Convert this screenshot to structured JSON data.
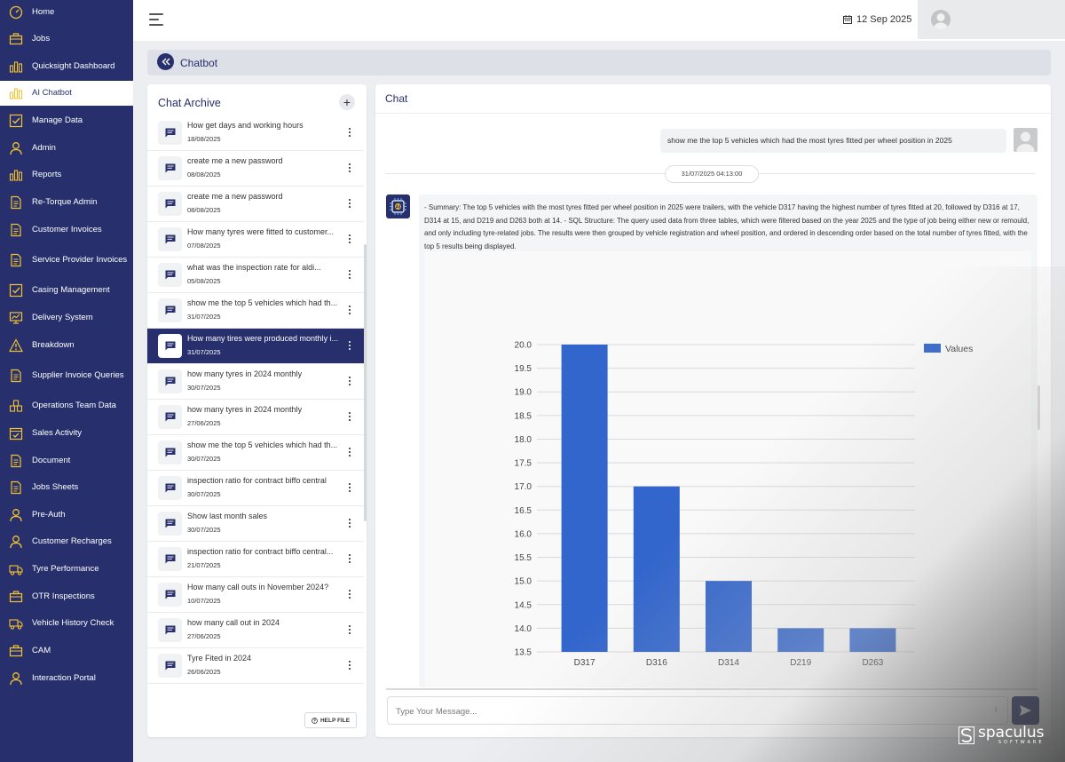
{
  "sidebar": {
    "items": [
      {
        "label": "Home",
        "icon": "dashboard-gauge-icon"
      },
      {
        "label": "Jobs",
        "icon": "briefcase-icon"
      },
      {
        "label": "Quicksight Dashboard",
        "icon": "bar-chart-icon"
      },
      {
        "label": "AI Chatbot",
        "icon": "bar-chart-icon",
        "active": true
      },
      {
        "label": "Manage Data",
        "icon": "checkbox-icon"
      },
      {
        "label": "Admin",
        "icon": "user-icon"
      },
      {
        "label": "Reports",
        "icon": "bar-chart-icon"
      },
      {
        "label": "Re-Torque Admin",
        "icon": "document-icon"
      },
      {
        "label": "Customer Invoices",
        "icon": "document-icon"
      },
      {
        "label": "Service Provider Invoices",
        "icon": "document-icon"
      },
      {
        "label": "Casing Management",
        "icon": "checkbox-icon"
      },
      {
        "label": "Delivery System",
        "icon": "monitor-chart-icon"
      },
      {
        "label": "Breakdown",
        "icon": "warning-icon"
      },
      {
        "label": "Supplier Invoice Queries",
        "icon": "document-icon"
      },
      {
        "label": "Operations Team Data",
        "icon": "warehouse-icon"
      },
      {
        "label": "Sales Activity",
        "icon": "calendar-check-icon"
      },
      {
        "label": "Document",
        "icon": "document-icon"
      },
      {
        "label": "Jobs Sheets",
        "icon": "document-icon"
      },
      {
        "label": "Pre-Auth",
        "icon": "user-icon"
      },
      {
        "label": "Customer Recharges",
        "icon": "user-icon"
      },
      {
        "label": "Tyre Performance",
        "icon": "truck-icon"
      },
      {
        "label": "OTR Inspections",
        "icon": "briefcase-icon"
      },
      {
        "label": "Vehicle History Check",
        "icon": "truck-icon"
      },
      {
        "label": "CAM",
        "icon": "briefcase-icon"
      },
      {
        "label": "Interaction Portal",
        "icon": "user-icon"
      }
    ]
  },
  "topbar": {
    "date": "12 Sep 2025"
  },
  "breadcrumb": {
    "title": "Chatbot"
  },
  "archive": {
    "title": "Chat Archive",
    "add_label": "+",
    "help_label": "HELP FILE",
    "items": [
      {
        "text": "How get days and working hours",
        "date": "18/08/2025"
      },
      {
        "text": "create me a new password",
        "date": "08/08/2025"
      },
      {
        "text": "create me a new password",
        "date": "08/08/2025"
      },
      {
        "text": "How many tyres were fitted to customer...",
        "date": "07/08/2025"
      },
      {
        "text": "what was the inspection rate for aldi...",
        "date": "05/08/2025"
      },
      {
        "text": "show me the top 5 vehicles which had th...",
        "date": "31/07/2025"
      },
      {
        "text": "How many tires were produced monthly i...",
        "date": "31/07/2025",
        "active": true
      },
      {
        "text": "how many tyres in 2024 monthly",
        "date": "30/07/2025"
      },
      {
        "text": "how many tyres in 2024 monthly",
        "date": "27/06/2025"
      },
      {
        "text": "show me the top 5 vehicles which had th...",
        "date": "30/07/2025"
      },
      {
        "text": "inspection ratio for contract biffo central",
        "date": "30/07/2025"
      },
      {
        "text": "Show last month sales",
        "date": "30/07/2025"
      },
      {
        "text": "inspection ratio for contract biffo central...",
        "date": "21/07/2025"
      },
      {
        "text": "How many call outs in November 2024?",
        "date": "10/07/2025"
      },
      {
        "text": "how many call out in 2024",
        "date": "27/06/2025"
      },
      {
        "text": "Tyre Fited in 2024",
        "date": "26/06/2025"
      }
    ]
  },
  "chat": {
    "title": "Chat",
    "user_message": "show me the top 5 vehicles which had the most tyres fitted per wheel position in 2025",
    "timestamp": "31/07/2025 04:13:00",
    "bot_message": "- Summary: The top 5 vehicles with the most tyres fitted per wheel position in 2025 were trailers, with the vehicle D317 having the highest number of tyres fitted at 20, followed by D316 at 17, D314 at 15, and D219 and D263 both at 14. - SQL Structure: The query used data from three tables, which were filtered based on the year 2025 and the type of job being either new or remould, and only including tyre-related jobs. The results were then grouped by vehicle registration and wheel position, and ordered in descending order based on the total number of tyres fitted, with the top 5 results being displayed.",
    "input_placeholder": "Type Your Message..."
  },
  "chart_data": {
    "type": "bar",
    "categories": [
      "D317",
      "D316",
      "D314",
      "D219",
      "D263"
    ],
    "series": [
      {
        "name": "Values",
        "values": [
          20,
          17,
          15,
          14,
          14
        ]
      }
    ],
    "ylim": [
      13.5,
      20.0
    ],
    "yticks": [
      "20.0",
      "19.5",
      "19.0",
      "18.5",
      "18.0",
      "17.5",
      "17.0",
      "16.5",
      "16.0",
      "15.5",
      "15.0",
      "14.5",
      "14.0",
      "13.5"
    ],
    "legend_position": "top-right",
    "grid": true,
    "bar_color": "#3366cc"
  },
  "brand": {
    "name": "spaculus",
    "sub": "SOFTWARE"
  },
  "colors": {
    "sidebar": "#27306c",
    "accent": "#27306c"
  }
}
